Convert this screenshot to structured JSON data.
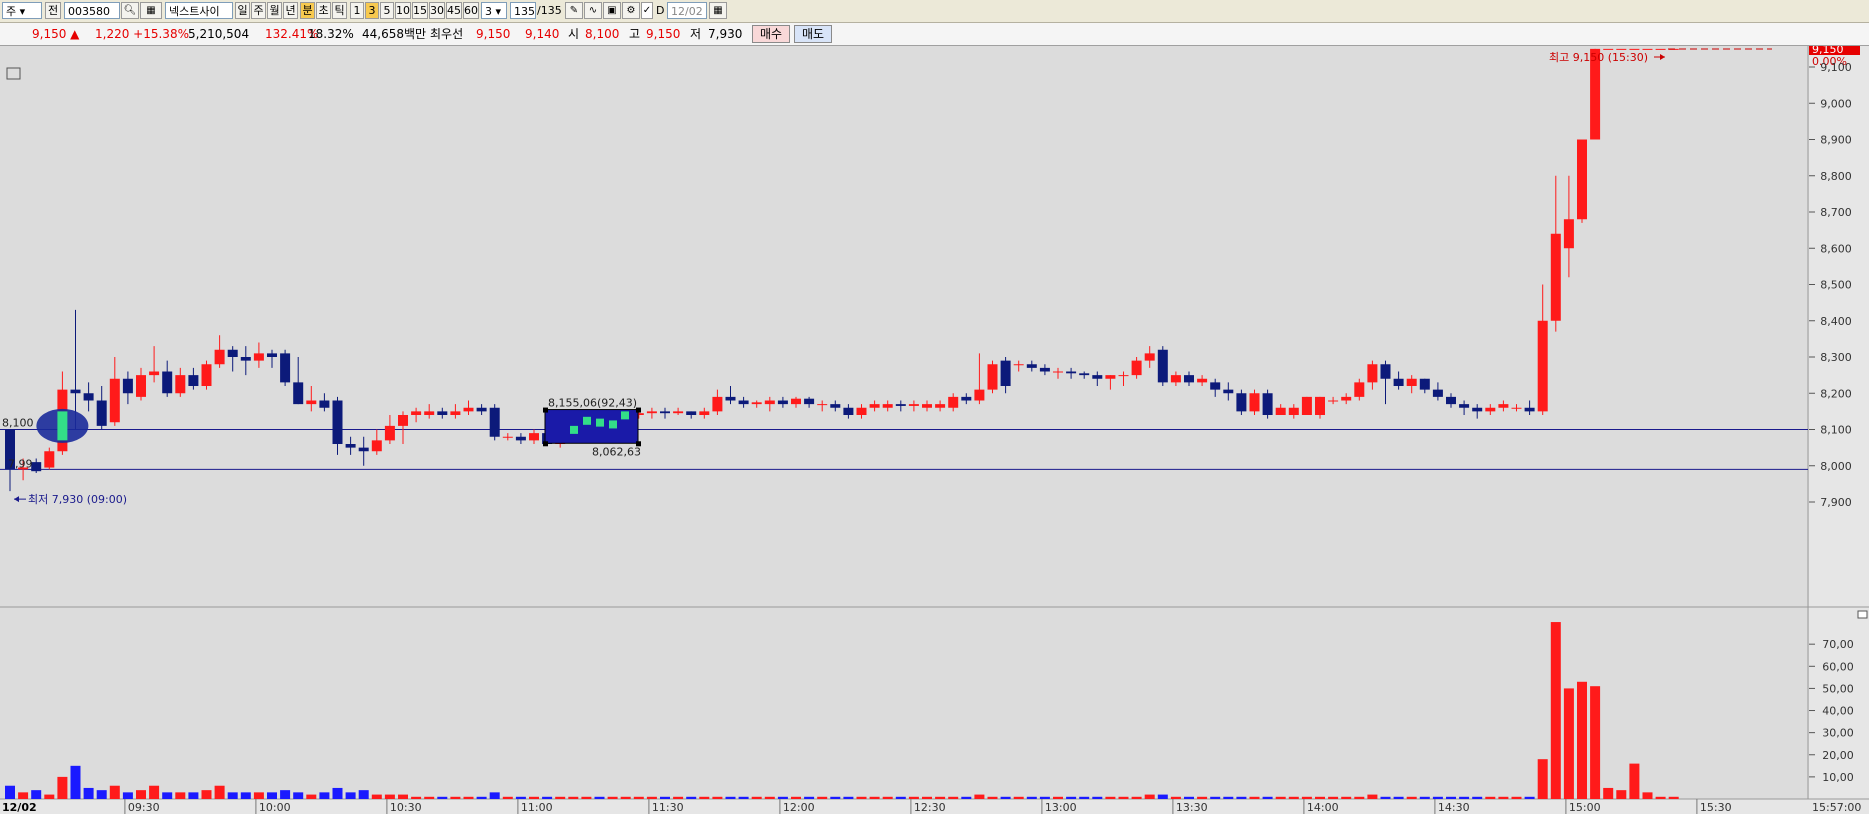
{
  "toolbar": {
    "market": "주",
    "range": "전",
    "code": "003580",
    "stock_name": "넥스트사이",
    "periods": [
      "일",
      "주",
      "월",
      "년"
    ],
    "intervals": [
      "분",
      "초",
      "틱"
    ],
    "minutes": [
      "1",
      "3",
      "5",
      "10",
      "15",
      "30",
      "45",
      "60"
    ],
    "minute_value": "3",
    "count": "135",
    "count_total": "/135",
    "checkbox_label": "D",
    "date": "12/02"
  },
  "quote": {
    "price": "9,150 ▲",
    "change": "1,220 +15.38%",
    "volume": "5,210,504",
    "volume_ratio": "132.41%",
    "turnover": "18.32%",
    "amount": "44,658백만",
    "bid_label": "최우선",
    "bid_sell": "9,150",
    "bid_buy": "9,140",
    "open_label": "시",
    "open": "8,100",
    "high_label": "고",
    "high": "9,150",
    "low_label": "저",
    "low": "7,930",
    "buy_button": "매수",
    "sell_button": "매도"
  },
  "chart_data": {
    "type": "candlestick",
    "date_label": "12/02",
    "x_labels": [
      "09:30",
      "10:00",
      "10:30",
      "11:00",
      "11:30",
      "12:00",
      "12:30",
      "13:00",
      "13:30",
      "14:00",
      "14:30",
      "15:00",
      "15:30",
      "15:57:00"
    ],
    "price_ticks": [
      "9,100",
      "9,000",
      "8,900",
      "8,800",
      "8,700",
      "8,600",
      "8,500",
      "8,400",
      "8,300",
      "8,200",
      "8,100",
      "8,000",
      "7,900"
    ],
    "price_range": [
      7850,
      9250
    ],
    "volume_ticks": [
      "70,00",
      "60,00",
      "50,00",
      "40,00",
      "30,00",
      "20,00",
      "10,00"
    ],
    "volume_range": [
      0,
      85
    ],
    "current_price_tag": "9,150",
    "current_pct": "0.00%",
    "high_annotation": "최고 9,150 (15:30)",
    "low_annotation": "최저 7,930 (09:00)",
    "reference_line_label": "8,100",
    "reference_line": 8100,
    "lower_line": 7990,
    "lower_line_label": "7,99",
    "box_top_label": "8,155,06(92,43)",
    "box_bottom_label": "8,062,63",
    "candles": [
      {
        "o": 8100,
        "h": 8100,
        "l": 7930,
        "c": 7990,
        "v": 6
      },
      {
        "o": 7990,
        "h": 8020,
        "l": 7960,
        "c": 7995,
        "v": 3
      },
      {
        "o": 8010,
        "h": 8020,
        "l": 7980,
        "c": 7985,
        "v": 4
      },
      {
        "o": 7995,
        "h": 8050,
        "l": 7990,
        "c": 8040,
        "v": 2
      },
      {
        "o": 8040,
        "h": 8260,
        "l": 8030,
        "c": 8210,
        "v": 10
      },
      {
        "o": 8210,
        "h": 8430,
        "l": 8100,
        "c": 8200,
        "v": 15
      },
      {
        "o": 8200,
        "h": 8230,
        "l": 8150,
        "c": 8180,
        "v": 5
      },
      {
        "o": 8180,
        "h": 8220,
        "l": 8100,
        "c": 8110,
        "v": 4
      },
      {
        "o": 8120,
        "h": 8300,
        "l": 8110,
        "c": 8240,
        "v": 6
      },
      {
        "o": 8240,
        "h": 8260,
        "l": 8170,
        "c": 8200,
        "v": 3
      },
      {
        "o": 8190,
        "h": 8270,
        "l": 8180,
        "c": 8250,
        "v": 4
      },
      {
        "o": 8250,
        "h": 8330,
        "l": 8230,
        "c": 8260,
        "v": 6
      },
      {
        "o": 8260,
        "h": 8290,
        "l": 8190,
        "c": 8200,
        "v": 3
      },
      {
        "o": 8200,
        "h": 8270,
        "l": 8190,
        "c": 8250,
        "v": 3
      },
      {
        "o": 8250,
        "h": 8270,
        "l": 8210,
        "c": 8220,
        "v": 3
      },
      {
        "o": 8220,
        "h": 8290,
        "l": 8210,
        "c": 8280,
        "v": 4
      },
      {
        "o": 8280,
        "h": 8360,
        "l": 8270,
        "c": 8320,
        "v": 6
      },
      {
        "o": 8320,
        "h": 8330,
        "l": 8260,
        "c": 8300,
        "v": 3
      },
      {
        "o": 8300,
        "h": 8330,
        "l": 8250,
        "c": 8290,
        "v": 3
      },
      {
        "o": 8290,
        "h": 8340,
        "l": 8270,
        "c": 8310,
        "v": 3
      },
      {
        "o": 8310,
        "h": 8320,
        "l": 8270,
        "c": 8300,
        "v": 3
      },
      {
        "o": 8310,
        "h": 8320,
        "l": 8220,
        "c": 8230,
        "v": 4
      },
      {
        "o": 8230,
        "h": 8300,
        "l": 8170,
        "c": 8170,
        "v": 3
      },
      {
        "o": 8170,
        "h": 8220,
        "l": 8150,
        "c": 8180,
        "v": 2
      },
      {
        "o": 8180,
        "h": 8200,
        "l": 8150,
        "c": 8160,
        "v": 3
      },
      {
        "o": 8180,
        "h": 8190,
        "l": 8030,
        "c": 8060,
        "v": 5
      },
      {
        "o": 8060,
        "h": 8080,
        "l": 8030,
        "c": 8050,
        "v": 3
      },
      {
        "o": 8050,
        "h": 8080,
        "l": 8000,
        "c": 8040,
        "v": 4
      },
      {
        "o": 8040,
        "h": 8100,
        "l": 8030,
        "c": 8070,
        "v": 2
      },
      {
        "o": 8070,
        "h": 8140,
        "l": 8060,
        "c": 8110,
        "v": 2
      },
      {
        "o": 8110,
        "h": 8150,
        "l": 8060,
        "c": 8140,
        "v": 2
      },
      {
        "o": 8140,
        "h": 8160,
        "l": 8120,
        "c": 8150,
        "v": 1
      },
      {
        "o": 8140,
        "h": 8170,
        "l": 8130,
        "c": 8150,
        "v": 1
      },
      {
        "o": 8150,
        "h": 8160,
        "l": 8130,
        "c": 8140,
        "v": 1
      },
      {
        "o": 8140,
        "h": 8170,
        "l": 8130,
        "c": 8150,
        "v": 1
      },
      {
        "o": 8150,
        "h": 8180,
        "l": 8140,
        "c": 8160,
        "v": 1
      },
      {
        "o": 8160,
        "h": 8170,
        "l": 8140,
        "c": 8150,
        "v": 1
      },
      {
        "o": 8160,
        "h": 8170,
        "l": 8070,
        "c": 8080,
        "v": 3
      },
      {
        "o": 8080,
        "h": 8090,
        "l": 8070,
        "c": 8080,
        "v": 1
      },
      {
        "o": 8080,
        "h": 8090,
        "l": 8060,
        "c": 8070,
        "v": 1
      },
      {
        "o": 8070,
        "h": 8100,
        "l": 8060,
        "c": 8090,
        "v": 1
      },
      {
        "o": 8090,
        "h": 8100,
        "l": 8060,
        "c": 8060,
        "v": 1
      },
      {
        "o": 8060,
        "h": 8100,
        "l": 8050,
        "c": 8090,
        "v": 1
      },
      {
        "o": 8090,
        "h": 8110,
        "l": 8070,
        "c": 8100,
        "v": 1
      },
      {
        "o": 8100,
        "h": 8120,
        "l": 8080,
        "c": 8110,
        "v": 1
      },
      {
        "o": 8110,
        "h": 8130,
        "l": 8090,
        "c": 8100,
        "v": 1
      },
      {
        "o": 8100,
        "h": 8140,
        "l": 8090,
        "c": 8130,
        "v": 1
      },
      {
        "o": 8130,
        "h": 8150,
        "l": 8120,
        "c": 8140,
        "v": 1
      },
      {
        "o": 8140,
        "h": 8150,
        "l": 8130,
        "c": 8145,
        "v": 1
      },
      {
        "o": 8145,
        "h": 8160,
        "l": 8130,
        "c": 8150,
        "v": 1
      },
      {
        "o": 8150,
        "h": 8160,
        "l": 8130,
        "c": 8145,
        "v": 1
      },
      {
        "o": 8145,
        "h": 8160,
        "l": 8140,
        "c": 8150,
        "v": 1
      },
      {
        "o": 8150,
        "h": 8150,
        "l": 8130,
        "c": 8140,
        "v": 1
      },
      {
        "o": 8140,
        "h": 8160,
        "l": 8130,
        "c": 8150,
        "v": 1
      },
      {
        "o": 8150,
        "h": 8210,
        "l": 8140,
        "c": 8190,
        "v": 1
      },
      {
        "o": 8190,
        "h": 8220,
        "l": 8170,
        "c": 8180,
        "v": 1
      },
      {
        "o": 8180,
        "h": 8190,
        "l": 8160,
        "c": 8170,
        "v": 1
      },
      {
        "o": 8170,
        "h": 8180,
        "l": 8160,
        "c": 8175,
        "v": 1
      },
      {
        "o": 8170,
        "h": 8190,
        "l": 8150,
        "c": 8180,
        "v": 1
      },
      {
        "o": 8180,
        "h": 8190,
        "l": 8160,
        "c": 8170,
        "v": 1
      },
      {
        "o": 8170,
        "h": 8190,
        "l": 8160,
        "c": 8185,
        "v": 1
      },
      {
        "o": 8185,
        "h": 8190,
        "l": 8160,
        "c": 8170,
        "v": 1
      },
      {
        "o": 8170,
        "h": 8180,
        "l": 8150,
        "c": 8170,
        "v": 1
      },
      {
        "o": 8170,
        "h": 8180,
        "l": 8150,
        "c": 8160,
        "v": 1
      },
      {
        "o": 8160,
        "h": 8170,
        "l": 8130,
        "c": 8140,
        "v": 1
      },
      {
        "o": 8140,
        "h": 8170,
        "l": 8130,
        "c": 8160,
        "v": 1
      },
      {
        "o": 8160,
        "h": 8180,
        "l": 8150,
        "c": 8170,
        "v": 1
      },
      {
        "o": 8160,
        "h": 8180,
        "l": 8150,
        "c": 8170,
        "v": 1
      },
      {
        "o": 8170,
        "h": 8180,
        "l": 8150,
        "c": 8165,
        "v": 1
      },
      {
        "o": 8165,
        "h": 8180,
        "l": 8150,
        "c": 8170,
        "v": 1
      },
      {
        "o": 8160,
        "h": 8180,
        "l": 8150,
        "c": 8170,
        "v": 1
      },
      {
        "o": 8160,
        "h": 8180,
        "l": 8150,
        "c": 8170,
        "v": 1
      },
      {
        "o": 8160,
        "h": 8200,
        "l": 8150,
        "c": 8190,
        "v": 1
      },
      {
        "o": 8190,
        "h": 8200,
        "l": 8170,
        "c": 8180,
        "v": 1
      },
      {
        "o": 8180,
        "h": 8310,
        "l": 8170,
        "c": 8210,
        "v": 2
      },
      {
        "o": 8210,
        "h": 8290,
        "l": 8200,
        "c": 8280,
        "v": 1
      },
      {
        "o": 8290,
        "h": 8300,
        "l": 8200,
        "c": 8220,
        "v": 1
      },
      {
        "o": 8280,
        "h": 8290,
        "l": 8260,
        "c": 8280,
        "v": 1
      },
      {
        "o": 8280,
        "h": 8290,
        "l": 8260,
        "c": 8270,
        "v": 1
      },
      {
        "o": 8270,
        "h": 8280,
        "l": 8250,
        "c": 8260,
        "v": 1
      },
      {
        "o": 8260,
        "h": 8270,
        "l": 8240,
        "c": 8260,
        "v": 1
      },
      {
        "o": 8260,
        "h": 8270,
        "l": 8240,
        "c": 8255,
        "v": 1
      },
      {
        "o": 8255,
        "h": 8260,
        "l": 8240,
        "c": 8250,
        "v": 1
      },
      {
        "o": 8250,
        "h": 8260,
        "l": 8220,
        "c": 8240,
        "v": 1
      },
      {
        "o": 8240,
        "h": 8250,
        "l": 8210,
        "c": 8250,
        "v": 1
      },
      {
        "o": 8250,
        "h": 8260,
        "l": 8220,
        "c": 8250,
        "v": 1
      },
      {
        "o": 8250,
        "h": 8300,
        "l": 8240,
        "c": 8290,
        "v": 1
      },
      {
        "o": 8290,
        "h": 8330,
        "l": 8270,
        "c": 8310,
        "v": 2
      },
      {
        "o": 8320,
        "h": 8330,
        "l": 8220,
        "c": 8230,
        "v": 2
      },
      {
        "o": 8230,
        "h": 8260,
        "l": 8220,
        "c": 8250,
        "v": 1
      },
      {
        "o": 8250,
        "h": 8260,
        "l": 8220,
        "c": 8230,
        "v": 1
      },
      {
        "o": 8230,
        "h": 8250,
        "l": 8220,
        "c": 8240,
        "v": 1
      },
      {
        "o": 8230,
        "h": 8240,
        "l": 8190,
        "c": 8210,
        "v": 1
      },
      {
        "o": 8210,
        "h": 8230,
        "l": 8180,
        "c": 8200,
        "v": 1
      },
      {
        "o": 8200,
        "h": 8210,
        "l": 8140,
        "c": 8150,
        "v": 1
      },
      {
        "o": 8150,
        "h": 8210,
        "l": 8140,
        "c": 8200,
        "v": 1
      },
      {
        "o": 8200,
        "h": 8210,
        "l": 8130,
        "c": 8140,
        "v": 1
      },
      {
        "o": 8140,
        "h": 8170,
        "l": 8140,
        "c": 8160,
        "v": 1
      },
      {
        "o": 8140,
        "h": 8170,
        "l": 8130,
        "c": 8160,
        "v": 1
      },
      {
        "o": 8140,
        "h": 8190,
        "l": 8140,
        "c": 8190,
        "v": 1
      },
      {
        "o": 8140,
        "h": 8190,
        "l": 8130,
        "c": 8190,
        "v": 1
      },
      {
        "o": 8180,
        "h": 8190,
        "l": 8170,
        "c": 8180,
        "v": 1
      },
      {
        "o": 8180,
        "h": 8200,
        "l": 8170,
        "c": 8190,
        "v": 1
      },
      {
        "o": 8190,
        "h": 8240,
        "l": 8180,
        "c": 8230,
        "v": 1
      },
      {
        "o": 8230,
        "h": 8290,
        "l": 8210,
        "c": 8280,
        "v": 2
      },
      {
        "o": 8280,
        "h": 8290,
        "l": 8170,
        "c": 8240,
        "v": 1
      },
      {
        "o": 8240,
        "h": 8260,
        "l": 8210,
        "c": 8220,
        "v": 1
      },
      {
        "o": 8220,
        "h": 8250,
        "l": 8200,
        "c": 8240,
        "v": 1
      },
      {
        "o": 8240,
        "h": 8240,
        "l": 8200,
        "c": 8210,
        "v": 1
      },
      {
        "o": 8210,
        "h": 8230,
        "l": 8180,
        "c": 8190,
        "v": 1
      },
      {
        "o": 8190,
        "h": 8200,
        "l": 8160,
        "c": 8170,
        "v": 1
      },
      {
        "o": 8170,
        "h": 8180,
        "l": 8140,
        "c": 8160,
        "v": 1
      },
      {
        "o": 8160,
        "h": 8170,
        "l": 8130,
        "c": 8150,
        "v": 1
      },
      {
        "o": 8150,
        "h": 8170,
        "l": 8140,
        "c": 8160,
        "v": 1
      },
      {
        "o": 8160,
        "h": 8180,
        "l": 8150,
        "c": 8170,
        "v": 1
      },
      {
        "o": 8160,
        "h": 8170,
        "l": 8150,
        "c": 8160,
        "v": 1
      },
      {
        "o": 8160,
        "h": 8180,
        "l": 8140,
        "c": 8150,
        "v": 1
      },
      {
        "o": 8150,
        "h": 8500,
        "l": 8140,
        "c": 8400,
        "v": 18
      },
      {
        "o": 8400,
        "h": 8800,
        "l": 8370,
        "c": 8640,
        "v": 80
      },
      {
        "o": 8600,
        "h": 8800,
        "l": 8520,
        "c": 8680,
        "v": 50
      },
      {
        "o": 8680,
        "h": 8900,
        "l": 8670,
        "c": 8900,
        "v": 53
      },
      {
        "o": 8900,
        "h": 9150,
        "l": 8900,
        "c": 9150,
        "v": 51
      },
      {
        "o": 9150,
        "h": 9150,
        "l": 9150,
        "c": 9150,
        "v": 5
      },
      {
        "o": 9150,
        "h": 9150,
        "l": 9150,
        "c": 9150,
        "v": 4
      },
      {
        "o": 9150,
        "h": 9150,
        "l": 9150,
        "c": 9150,
        "v": 16
      },
      {
        "o": 9150,
        "h": 9150,
        "l": 9150,
        "c": 9150,
        "v": 3
      },
      {
        "o": 9150,
        "h": 9150,
        "l": 9150,
        "c": 9150,
        "v": 1
      },
      {
        "o": 9150,
        "h": 9150,
        "l": 9150,
        "c": 9150,
        "v": 1
      }
    ]
  }
}
